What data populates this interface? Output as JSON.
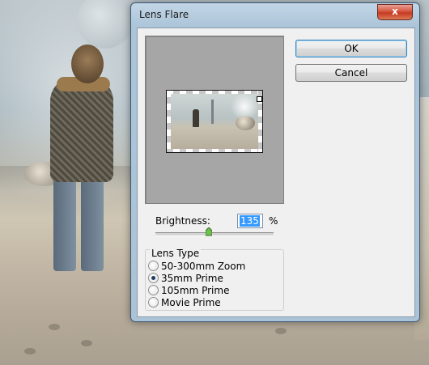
{
  "dialog": {
    "title": "Lens Flare",
    "close_glyph": "x",
    "ok_label": "OK",
    "cancel_label": "Cancel"
  },
  "brightness": {
    "label": "Brightness:",
    "value": "135",
    "unit": "%",
    "slider_fraction": 0.45
  },
  "lens_type": {
    "title": "Lens Type",
    "options": [
      {
        "label": "50-300mm Zoom",
        "checked": false
      },
      {
        "label": "35mm Prime",
        "checked": true
      },
      {
        "label": "105mm Prime",
        "checked": false
      },
      {
        "label": "Movie Prime",
        "checked": false
      }
    ]
  },
  "colors": {
    "default_button_border": "#3c7fb1",
    "selection_highlight": "#3399ff",
    "close_button": "#c53a22"
  }
}
